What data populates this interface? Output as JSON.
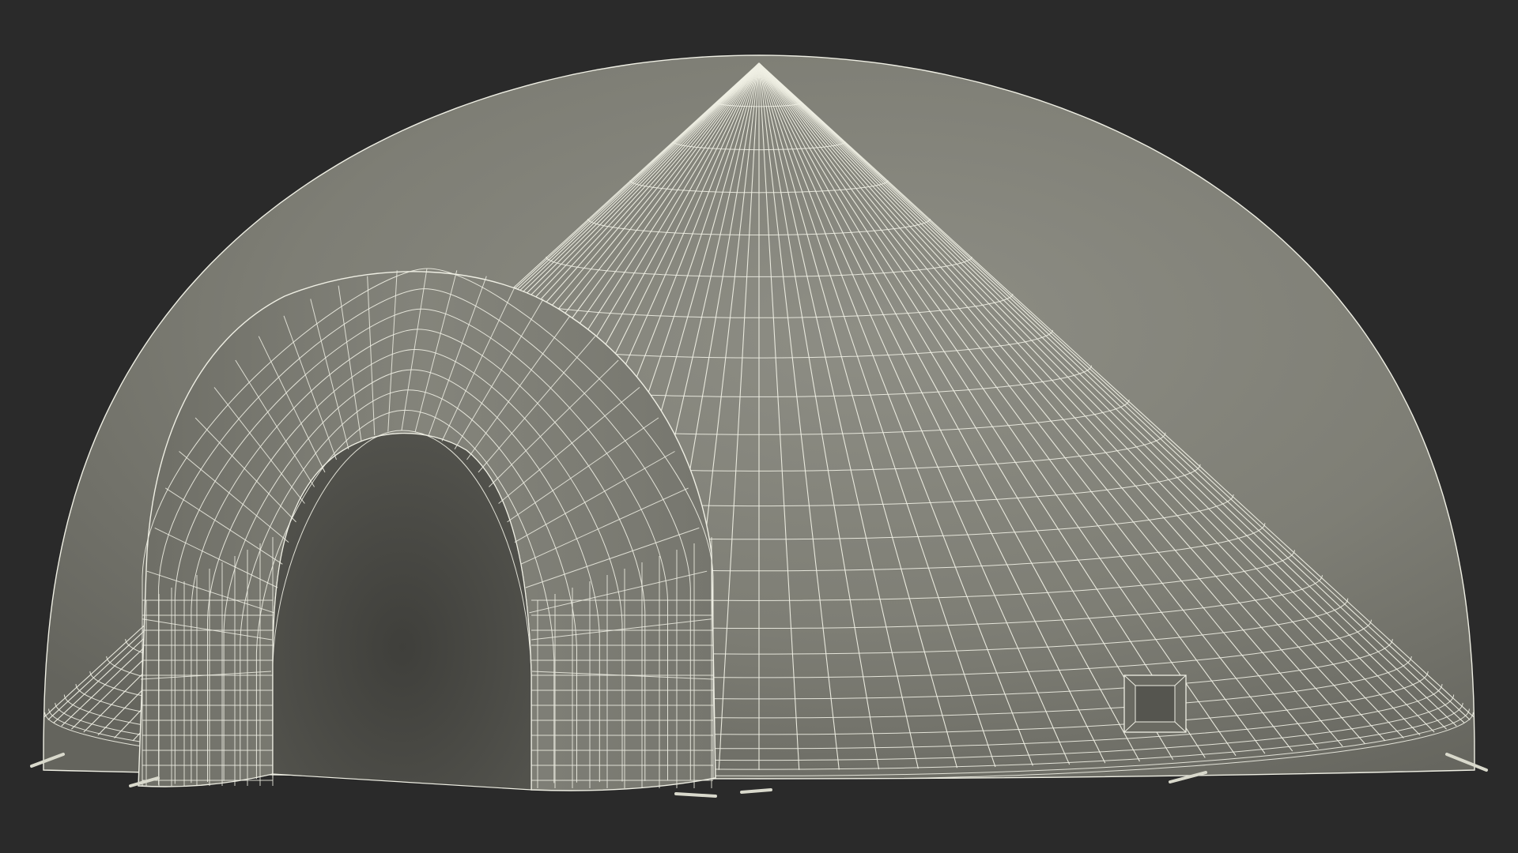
{
  "scene": {
    "subject": "inflatable-dome-tent-wireframe",
    "colors": {
      "background": "#2a2a2a",
      "surface_light": "#8b8b82",
      "surface_mid": "#7b7b72",
      "surface_dark": "#5e5e57",
      "interior_dark": "#4a4a45",
      "wire": "#efefe4",
      "stake": "#d9d9cc"
    }
  }
}
